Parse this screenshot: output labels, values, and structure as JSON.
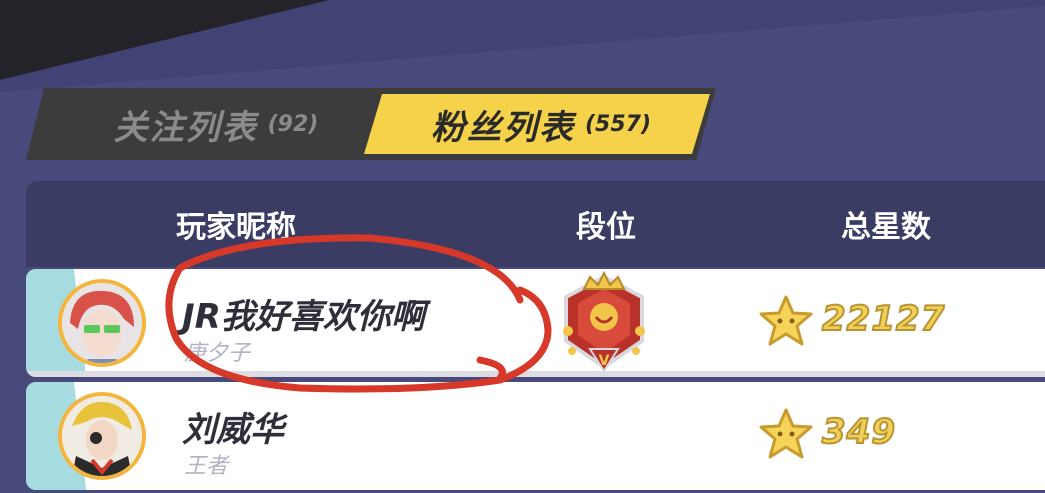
{
  "tabs": [
    {
      "label": "关注列表",
      "count": "(92)",
      "active": false
    },
    {
      "label": "粉丝列表",
      "count": "(557)",
      "active": true
    }
  ],
  "table": {
    "headers": {
      "name": "玩家昵称",
      "rank": "段位",
      "stars": "总星数"
    },
    "rows": [
      {
        "name": "JR我好喜欢你啊",
        "sub": "庚夕子",
        "rank_icon": "rank-badge-icon",
        "stars": "22127"
      },
      {
        "name": "刘威华",
        "sub": "王者",
        "rank_icon": "",
        "stars": "349"
      }
    ]
  },
  "colors": {
    "background": "#484a7c",
    "header": "#3a3c64",
    "active_tab": "#f5d24a",
    "inactive_tab": "#3c3c3c",
    "row_accent": "#a6dce0",
    "star": "#f2cf56",
    "annotation": "#d6382a"
  }
}
